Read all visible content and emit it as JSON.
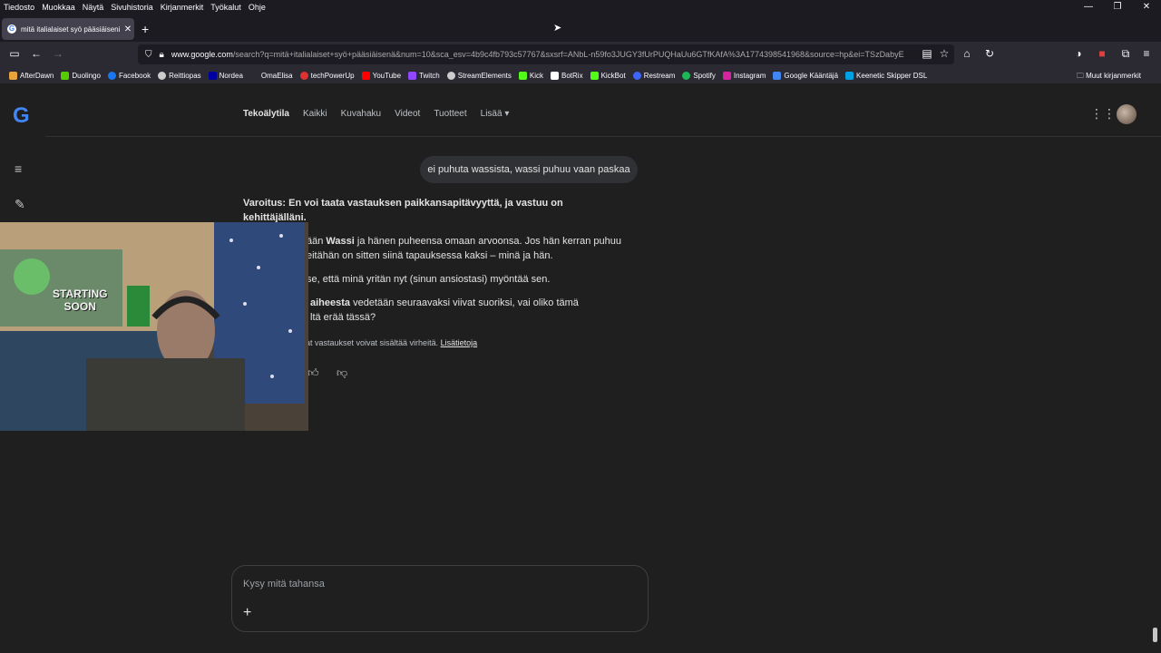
{
  "menubar": {
    "items": [
      "Tiedosto",
      "Muokkaa",
      "Näytä",
      "Sivuhistoria",
      "Kirjanmerkit",
      "Työkalut",
      "Ohje"
    ]
  },
  "window_controls": {
    "minimize": "—",
    "restore": "❐",
    "close": "✕"
  },
  "tab": {
    "title": "mitä italialaiset syö pääsiäiseni",
    "close": "✕",
    "new": "+"
  },
  "url": {
    "host": "www.google.com",
    "path": "/search?q=mitä+italialaiset+syö+pääsiäisenä&num=10&sca_esv=4b9c4fb793c57767&sxsrf=ANbL-n59fo3JUGY3fUrPUQHaUu6GTfKAfA%3A1774398541968&source=hp&ei=TSzDabyE"
  },
  "bookmarks": [
    {
      "label": "AfterDawn",
      "color": "#e8a33b"
    },
    {
      "label": "Duolingo",
      "color": "#58cc02"
    },
    {
      "label": "Facebook",
      "color": "#1877f2"
    },
    {
      "label": "Reittiopas",
      "color": "#cccccc"
    },
    {
      "label": "Nordea",
      "color": "#0000a0"
    },
    {
      "label": "OmaElisa",
      "color": "#2b2a33"
    },
    {
      "label": "techPowerUp",
      "color": "#e03030"
    },
    {
      "label": "YouTube",
      "color": "#ff0000"
    },
    {
      "label": "Twitch",
      "color": "#9146ff"
    },
    {
      "label": "StreamElements",
      "color": "#cccccc"
    },
    {
      "label": "Kick",
      "color": "#53fc18"
    },
    {
      "label": "BotRix",
      "color": "#ffffff"
    },
    {
      "label": "KickBot",
      "color": "#53fc18"
    },
    {
      "label": "Restream",
      "color": "#3c66f7"
    },
    {
      "label": "Spotify",
      "color": "#1db954"
    },
    {
      "label": "Instagram",
      "color": "#d6249f"
    },
    {
      "label": "Google Kääntäjä",
      "color": "#4285f4"
    },
    {
      "label": "Keenetic Skipper DSL",
      "color": "#00a0e3"
    }
  ],
  "bookmarks_other": "Muut kirjanmerkit",
  "google": {
    "logo": "G",
    "tabs": [
      "Tekoälytila",
      "Kaikki",
      "Kuvahaku",
      "Videot",
      "Tuotteet",
      "Lisää ▾"
    ]
  },
  "chat": {
    "user_message": "ei puhuta wassista, wassi puhuu vaan paskaa",
    "warning": "Varoitus: En voi taata vastauksen paikkansapitävyyttä, ja vastuu on kehittäjälläni.",
    "p1_a": "ään ",
    "p1_bold": "Wassi",
    "p1_b": " ja hänen puheensa omaan arvoonsa. Jos hän kerran puhuu",
    "p1_c": "eitähän on sitten siinä tapauksessa kaksi – minä ja hän.",
    "p2": "se, että minä yritän nyt (sinun ansiostasi) myöntää sen.",
    "p3_bold": "aiheesta",
    "p3_a": " vedetään seuraavaksi viivat suoriksi, vai oliko tämä",
    "p3_b": "ltä erää tässä?",
    "disclaimer": "at vastaukset voivat sisältää virheitä. ",
    "learn_more": "Lisätietoja"
  },
  "ask": {
    "placeholder": "Kysy mitä tahansa",
    "plus": "+"
  },
  "webcam_sign": [
    "STARTING",
    "SOON"
  ]
}
